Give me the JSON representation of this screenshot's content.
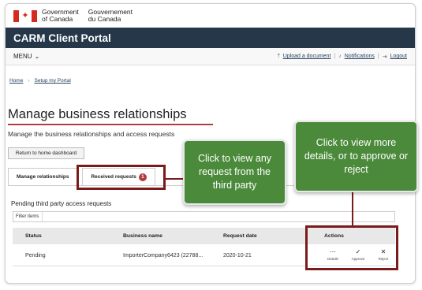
{
  "header": {
    "gov_en": "Government\nof Canada",
    "gov_fr": "Gouvernement\ndu Canada"
  },
  "portal": {
    "title": "CARM Client Portal"
  },
  "menubar": {
    "menu_label": "MENU",
    "upload_label": "Upload a document",
    "notifications_label": "Notifications",
    "logout_label": "Logout"
  },
  "breadcrumb": {
    "home": "Home",
    "setup": "Setup my Portal"
  },
  "page": {
    "title": "Manage business relationships",
    "subtitle": "Manage the business relationships and access requests",
    "return_button": "Return to home dashboard"
  },
  "tabs": [
    {
      "label": "Manage relationships"
    },
    {
      "label": "Received requests",
      "badge": "1"
    }
  ],
  "panel": {
    "title": "Pending third party access requests",
    "filter_label": "Filter items"
  },
  "table": {
    "headers": [
      "Status",
      "Business name",
      "Request date",
      "Actions"
    ],
    "rows": [
      {
        "status": "Pending",
        "business_name": "ImporterCompany6423 (22788...",
        "request_date": "2020-10-21"
      }
    ],
    "actions": [
      {
        "icon": "ellipsis-icon",
        "label": "Details"
      },
      {
        "icon": "check-icon",
        "label": "Approve"
      },
      {
        "icon": "x-icon",
        "label": "Reject"
      }
    ]
  },
  "callouts": {
    "view_request": "Click to view any request from the third party",
    "view_details": "Click to view more details, or to approve or reject"
  },
  "colors": {
    "flag_red": "#d52b1e",
    "banner": "#26374a",
    "callout_green": "#4a8a3a",
    "highlight_red": "#7a1b1b",
    "accent_rule": "#af3c43"
  }
}
